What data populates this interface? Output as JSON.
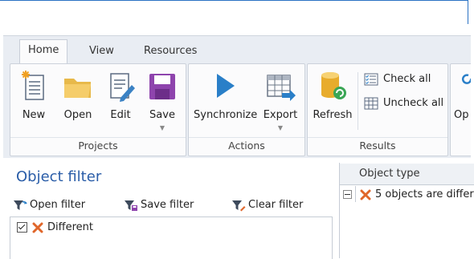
{
  "ribbon": {
    "tabs": [
      {
        "label": "Home",
        "active": true
      },
      {
        "label": "View",
        "active": false
      },
      {
        "label": "Resources",
        "active": false
      }
    ],
    "groups": {
      "projects": {
        "label": "Projects",
        "buttons": {
          "new": "New",
          "open": "Open",
          "edit": "Edit",
          "save": "Save"
        }
      },
      "actions": {
        "label": "Actions",
        "buttons": {
          "synchronize": "Synchronize",
          "export": "Export"
        }
      },
      "results": {
        "label": "Results",
        "buttons": {
          "refresh": "Refresh",
          "check_all": "Check all",
          "uncheck_all": "Uncheck all"
        }
      },
      "more": {
        "partial_label": "Op"
      }
    },
    "icons": {
      "new": "new-document-icon",
      "open": "folder-icon",
      "edit": "edit-document-icon",
      "save": "floppy-disk-icon",
      "synchronize": "play-arrow-icon",
      "export": "export-table-icon",
      "refresh": "database-refresh-icon",
      "check_all": "check-list-icon",
      "uncheck_all": "table-icon"
    }
  },
  "object_filter": {
    "title": "Object filter",
    "buttons": {
      "open_filter": "Open filter",
      "save_filter": "Save filter",
      "clear_filter": "Clear filter"
    },
    "items": [
      {
        "label": "Different",
        "checked": true,
        "icon": "different-x-icon"
      }
    ]
  },
  "grid": {
    "column_header": "Object type",
    "rows": [
      {
        "text": "5 objects are differ",
        "expanded": true,
        "icon": "different-x-icon"
      }
    ]
  },
  "colors": {
    "accent_blue": "#2a5da8",
    "frame_blue": "#2b73c4",
    "different_orange": "#e0662a",
    "save_purple": "#8e44ad"
  }
}
